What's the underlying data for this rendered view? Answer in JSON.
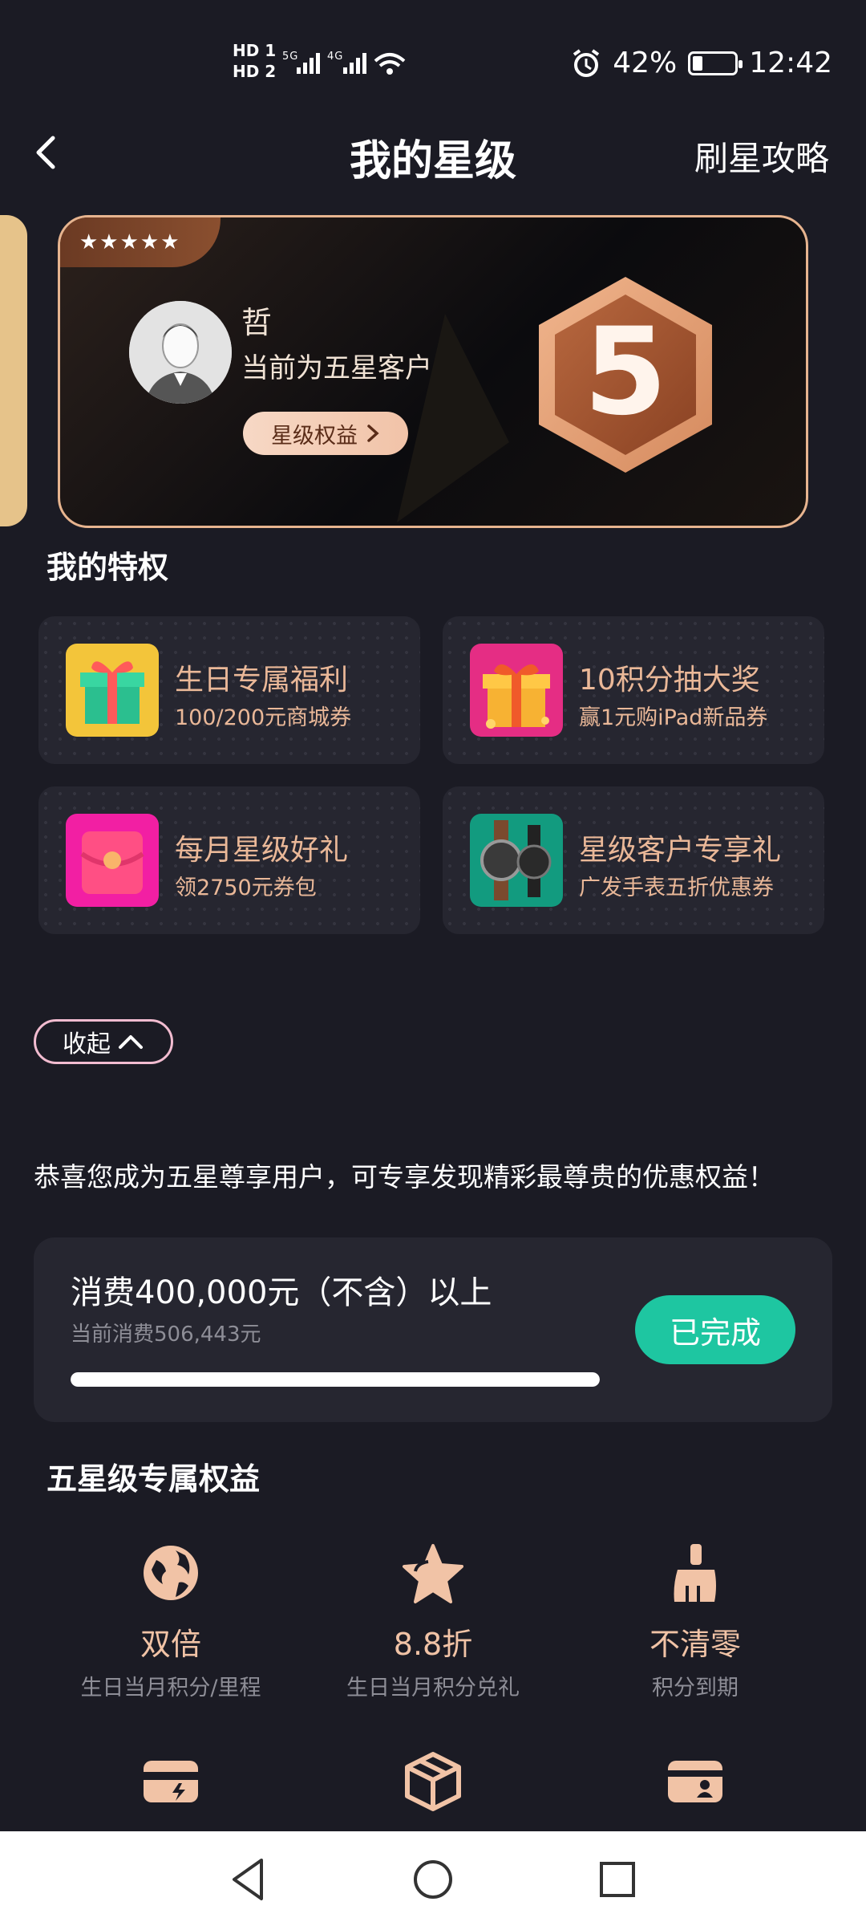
{
  "status_bar": {
    "hd1": "HD 1",
    "hd2": "HD 2",
    "network": "5G 4G",
    "battery": "42%",
    "time": "12:42"
  },
  "header": {
    "title": "我的星级",
    "guide": "刷星攻略"
  },
  "star_card": {
    "stars": "★★★★★",
    "user_name": "哲",
    "level_text": "当前为五星客户",
    "benefit_button": "星级权益",
    "badge_number": "5"
  },
  "privileges": {
    "title": "我的特权",
    "items": [
      {
        "title": "生日专属福利",
        "subtitle": "100/200元商城券",
        "icon": "gift-box-icon"
      },
      {
        "title": "10积分抽大奖",
        "subtitle": "赢1元购iPad新品券",
        "icon": "gift-ribbon-icon"
      },
      {
        "title": "每月星级好礼",
        "subtitle": "领2750元券包",
        "icon": "red-packet-icon"
      },
      {
        "title": "星级客户专享礼",
        "subtitle": "广发手表五折优惠券",
        "icon": "watch-icon"
      }
    ]
  },
  "collapse_label": "收起",
  "congrats_text": "恭喜您成为五星尊享用户，可专享发现精彩最尊贵的优惠权益！",
  "progress": {
    "goal": "消费400,000元（不含）以上",
    "current": "当前消费506,443元",
    "fill_fraction": 1.0,
    "status_button": "已完成"
  },
  "exclusive": {
    "title": "五星级专属权益",
    "items": [
      {
        "title": "双倍",
        "subtitle": "生日当月积分/里程",
        "icon": "globe-icon"
      },
      {
        "title": "8.8折",
        "subtitle": "生日当月积分兑礼",
        "icon": "star-icon"
      },
      {
        "title": "不清零",
        "subtitle": "积分到期",
        "icon": "broom-icon"
      }
    ],
    "row2_icons": [
      "card-flash-icon",
      "package-icon",
      "id-card-icon"
    ]
  },
  "colors": {
    "background": "#1b1b24",
    "accent": "#eab898",
    "success": "#1ec6a1"
  }
}
